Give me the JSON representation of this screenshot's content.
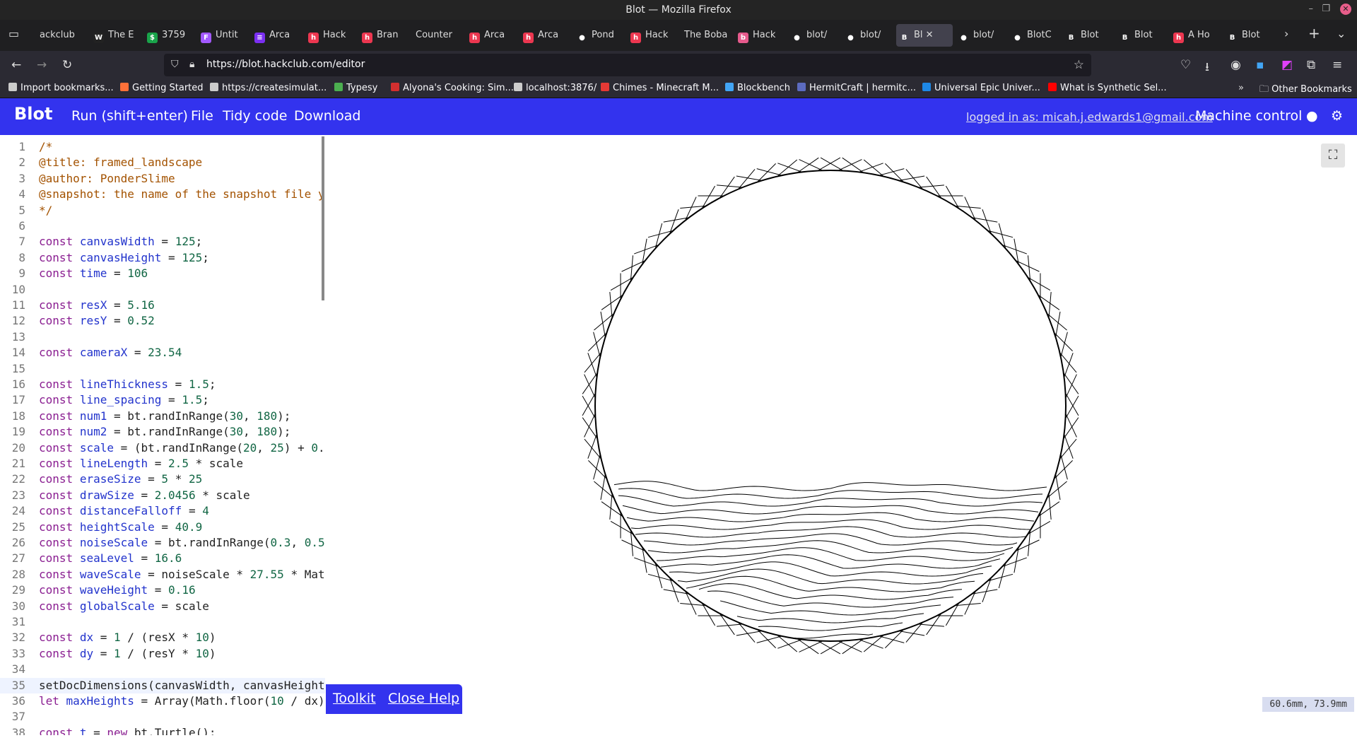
{
  "window": {
    "title": "Blot — Mozilla Firefox"
  },
  "tabs": [
    {
      "label": "ackclub",
      "icon": "back-arrow-icon",
      "color": "#444444",
      "glyph": ""
    },
    {
      "label": "The E",
      "icon": "w-logo-icon",
      "color": "#222222",
      "glyph": "W"
    },
    {
      "label": "3759",
      "icon": "green-circle-icon",
      "color": "#19a34a",
      "glyph": "$"
    },
    {
      "label": "Untit",
      "icon": "figma-icon",
      "color": "#a259ff",
      "glyph": "F"
    },
    {
      "label": "Arca",
      "icon": "arcade-icon",
      "color": "#7b2ff2",
      "glyph": "≡"
    },
    {
      "label": "Hack",
      "icon": "hackclub-icon",
      "color": "#ec3750",
      "glyph": "h"
    },
    {
      "label": "Bran",
      "icon": "hackclub-icon",
      "color": "#ec3750",
      "glyph": "h"
    },
    {
      "label": "Counter",
      "icon": "none",
      "color": "#1f1f21",
      "glyph": ""
    },
    {
      "label": "Arca",
      "icon": "hackclub-icon",
      "color": "#ec3750",
      "glyph": "h"
    },
    {
      "label": "Arca",
      "icon": "hackclub-icon",
      "color": "#ec3750",
      "glyph": "h"
    },
    {
      "label": "Pond",
      "icon": "github-icon",
      "color": "#1f1f21",
      "glyph": "●"
    },
    {
      "label": "Hack",
      "icon": "hackclub-icon",
      "color": "#ec3750",
      "glyph": "h"
    },
    {
      "label": "The Boba",
      "icon": "none",
      "color": "#1f1f21",
      "glyph": ""
    },
    {
      "label": "Hack",
      "icon": "boba-icon",
      "color": "#e65a8c",
      "glyph": "b"
    },
    {
      "label": "blot/",
      "icon": "github-icon",
      "color": "#1f1f21",
      "glyph": "●"
    },
    {
      "label": "blot/",
      "icon": "github-icon",
      "color": "#1f1f21",
      "glyph": "●"
    },
    {
      "label": "Bl",
      "icon": "blot-icon",
      "color": "#42414d",
      "glyph": "B",
      "active": true
    },
    {
      "label": "blot/",
      "icon": "github-icon",
      "color": "#1f1f21",
      "glyph": "●"
    },
    {
      "label": "BlotC",
      "icon": "github-icon",
      "color": "#1f1f21",
      "glyph": "●"
    },
    {
      "label": "Blot",
      "icon": "blot-icon",
      "color": "#1f1f21",
      "glyph": "B"
    },
    {
      "label": "Blot",
      "icon": "blot-icon",
      "color": "#1f1f21",
      "glyph": "B"
    },
    {
      "label": "A Ho",
      "icon": "hackclub-icon",
      "color": "#ec3750",
      "glyph": "h"
    },
    {
      "label": "Blot",
      "icon": "blot-icon",
      "color": "#1f1f21",
      "glyph": "B"
    }
  ],
  "nav": {
    "url": "https://blot.hackclub.com/editor"
  },
  "bookmarks": [
    {
      "label": "Import bookmarks...",
      "color": "#cccccc"
    },
    {
      "label": "Getting Started",
      "color": "#ff7139"
    },
    {
      "label": "https://createsimulat...",
      "color": "#cccccc"
    },
    {
      "label": "Typesy",
      "color": "#4caf50"
    },
    {
      "label": "Alyona's Cooking: Sim...",
      "color": "#d32f2f"
    },
    {
      "label": "localhost:3876/",
      "color": "#cccccc"
    },
    {
      "label": "Chimes - Minecraft M...",
      "color": "#e53935"
    },
    {
      "label": "Blockbench",
      "color": "#42a5f5"
    },
    {
      "label": "HermitCraft | hermitc...",
      "color": "#5c6bc0"
    },
    {
      "label": "Universal Epic Univer...",
      "color": "#1e88e5"
    },
    {
      "label": "What is Synthetic Sel...",
      "color": "#ff0000"
    }
  ],
  "other_bookmarks": "Other Bookmarks",
  "app": {
    "logo": "Blot",
    "menu": [
      "Run (shift+enter)",
      "File",
      "Tidy code",
      "Download"
    ],
    "login": "logged in as: micah.j.edwards1@gmail.com",
    "machine_control": "Machine control"
  },
  "code_lines": [
    "/*",
    "@title: framed_landscape",
    "@author: PonderSlime",
    "@snapshot: the name of the snapshot file y",
    "*/",
    "",
    "const canvasWidth = 125;",
    "const canvasHeight = 125;",
    "const time = 106",
    "",
    "const resX = 5.16",
    "const resY = 0.52",
    "",
    "const cameraX = 23.54",
    "",
    "const lineThickness = 1.5;",
    "const line_spacing = 1.5;",
    "const num1 = bt.randInRange(30, 180);",
    "const num2 = bt.randInRange(30, 180);",
    "const scale = (bt.randInRange(20, 25) + 0.",
    "const lineLength = 2.5 * scale",
    "const eraseSize = 5 * 25",
    "const drawSize = 2.0456 * scale",
    "const distanceFalloff = 4",
    "const heightScale = 40.9",
    "const noiseScale = bt.randInRange(0.3, 0.5",
    "const seaLevel = 16.6",
    "const waveScale = noiseScale * 27.55 * Mat",
    "const waveHeight = 0.16",
    "const globalScale = scale",
    "",
    "const dx = 1 / (resX * 10)",
    "const dy = 1 / (resY * 10)",
    "",
    "setDocDimensions(canvasWidth, canvasHeight",
    "let maxHeights = Array(Math.floor(10 / dx)",
    "",
    "const t = new bt.Turtle();"
  ],
  "current_line": 35,
  "help": {
    "toolkit": "Toolkit",
    "close": "Close Help"
  },
  "coords": "60.6mm, 73.9mm"
}
